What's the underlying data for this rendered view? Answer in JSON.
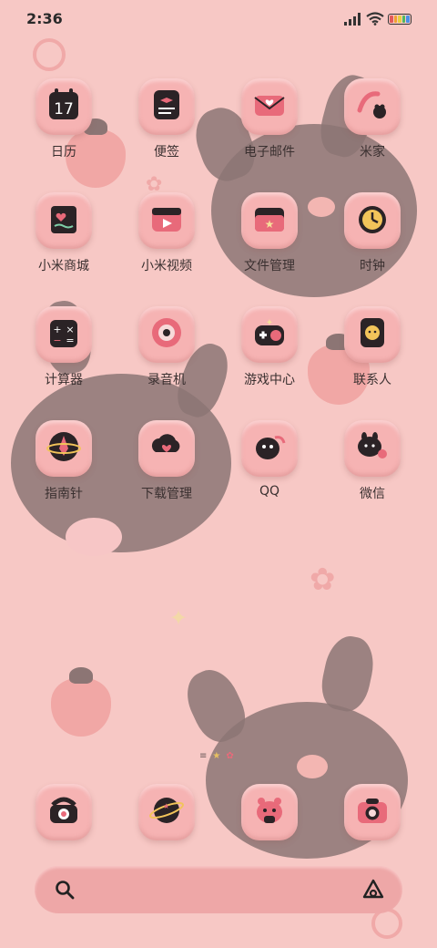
{
  "status_bar": {
    "time": "2:36",
    "icons": [
      "signal-icon",
      "wifi-icon",
      "battery-icon"
    ],
    "battery_colors": [
      "#e25a5a",
      "#f0a030",
      "#e8d040",
      "#50b860",
      "#4a8ee8"
    ]
  },
  "apps": [
    {
      "label": "日历",
      "icon": "calendar-icon",
      "number": "17"
    },
    {
      "label": "便签",
      "icon": "notes-icon"
    },
    {
      "label": "电子邮件",
      "icon": "mail-icon"
    },
    {
      "label": "米家",
      "icon": "mi-home-icon"
    },
    {
      "label": "小米商城",
      "icon": "mi-store-icon"
    },
    {
      "label": "小米视频",
      "icon": "video-icon"
    },
    {
      "label": "文件管理",
      "icon": "file-manager-icon"
    },
    {
      "label": "时钟",
      "icon": "clock-icon"
    },
    {
      "label": "计算器",
      "icon": "calculator-icon"
    },
    {
      "label": "录音机",
      "icon": "recorder-icon"
    },
    {
      "label": "游戏中心",
      "icon": "game-center-icon"
    },
    {
      "label": "联系人",
      "icon": "contacts-icon"
    },
    {
      "label": "指南针",
      "icon": "compass-icon"
    },
    {
      "label": "下载管理",
      "icon": "download-icon"
    },
    {
      "label": "QQ",
      "icon": "qq-icon"
    },
    {
      "label": "微信",
      "icon": "wechat-icon"
    }
  ],
  "dock": [
    {
      "icon": "phone-icon"
    },
    {
      "icon": "browser-icon"
    },
    {
      "icon": "messages-icon"
    },
    {
      "icon": "camera-icon"
    }
  ],
  "search_bar": {
    "icon_left": "search-icon",
    "icon_right": "assistant-icon"
  },
  "colors": {
    "background": "#f7c8c5",
    "tile": "#f6b3b3",
    "dark": "#2b2326",
    "accent": "#e86a7a"
  }
}
